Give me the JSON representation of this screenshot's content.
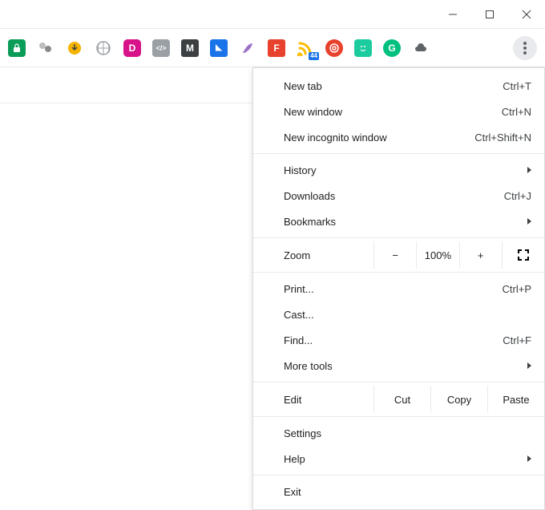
{
  "window_controls": {
    "minimize": "minimize",
    "maximize": "maximize",
    "close": "close"
  },
  "extensions": [
    {
      "name": "ext-green-lock",
      "bg": "#0b9d58",
      "glyph": "🔒"
    },
    {
      "name": "ext-gray-balls"
    },
    {
      "name": "ext-IDM"
    },
    {
      "name": "ext-basket"
    },
    {
      "name": "ext-D",
      "bg": "#d8138a",
      "glyph": "D"
    },
    {
      "name": "ext-code",
      "bg": "#9aa0a6",
      "glyph": "</>"
    },
    {
      "name": "ext-M",
      "bg": "#3c4043",
      "glyph": "M"
    },
    {
      "name": "ext-tag",
      "bg": "#1a73e8",
      "glyph": "◣"
    },
    {
      "name": "ext-feather"
    },
    {
      "name": "ext-F",
      "bg": "#e8412d",
      "glyph": "F"
    },
    {
      "name": "ext-rss",
      "bg": "transparent",
      "glyph": "📶",
      "badge": "44"
    },
    {
      "name": "ext-spiral",
      "bg": "#e8412d",
      "glyph": "◉"
    },
    {
      "name": "ext-smile",
      "bg": "#1ccc9e",
      "glyph": "☺"
    },
    {
      "name": "ext-G",
      "bg": "#00c07f",
      "glyph": "G"
    },
    {
      "name": "ext-cloud",
      "bg": "#5f6368",
      "glyph": "☁"
    }
  ],
  "menu": {
    "group1": [
      {
        "label": "New tab",
        "shortcut": "Ctrl+T"
      },
      {
        "label": "New window",
        "shortcut": "Ctrl+N"
      },
      {
        "label": "New incognito window",
        "shortcut": "Ctrl+Shift+N"
      }
    ],
    "group2": [
      {
        "label": "History",
        "submenu": true
      },
      {
        "label": "Downloads",
        "shortcut": "Ctrl+J"
      },
      {
        "label": "Bookmarks",
        "submenu": true
      }
    ],
    "zoom": {
      "label": "Zoom",
      "minus": "−",
      "value": "100%",
      "plus": "+"
    },
    "group3": [
      {
        "label": "Print...",
        "shortcut": "Ctrl+P"
      },
      {
        "label": "Cast..."
      },
      {
        "label": "Find...",
        "shortcut": "Ctrl+F"
      },
      {
        "label": "More tools",
        "submenu": true
      }
    ],
    "edit": {
      "label": "Edit",
      "cut": "Cut",
      "copy": "Copy",
      "paste": "Paste"
    },
    "group4": [
      {
        "label": "Settings"
      },
      {
        "label": "Help",
        "submenu": true
      }
    ],
    "group5": [
      {
        "label": "Exit"
      }
    ]
  }
}
